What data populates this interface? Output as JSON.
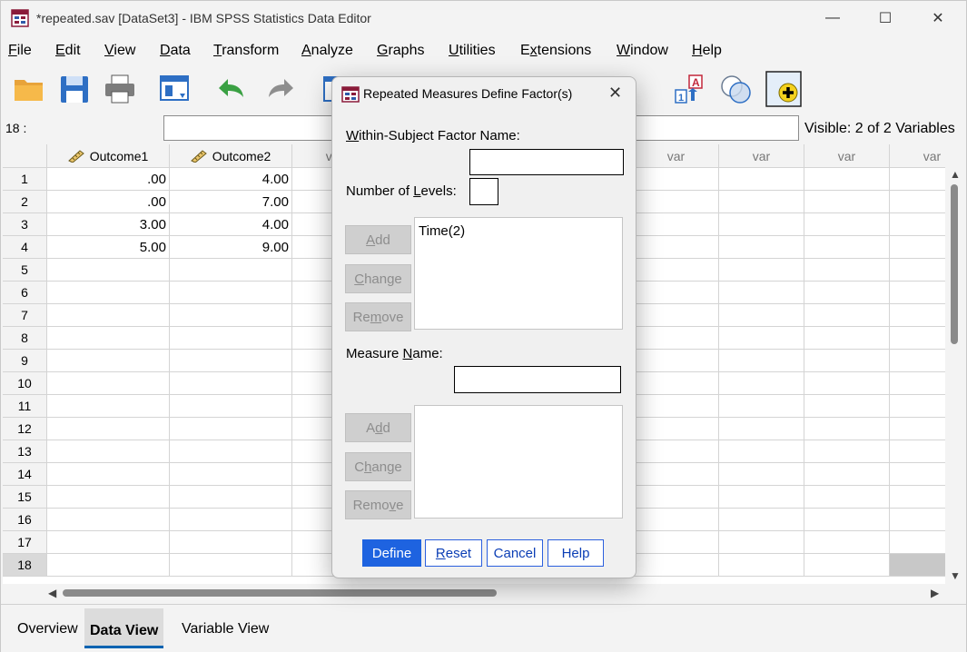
{
  "window": {
    "title": "*repeated.sav [DataSet3] - IBM SPSS Statistics Data Editor",
    "minimize": "—",
    "maximize": "☐",
    "close": "✕"
  },
  "menu": [
    {
      "pre": "",
      "key": "F",
      "post": "ile"
    },
    {
      "pre": "",
      "key": "E",
      "post": "dit"
    },
    {
      "pre": "",
      "key": "V",
      "post": "iew"
    },
    {
      "pre": "",
      "key": "D",
      "post": "ata"
    },
    {
      "pre": "",
      "key": "T",
      "post": "ransform"
    },
    {
      "pre": "",
      "key": "A",
      "post": "nalyze"
    },
    {
      "pre": "",
      "key": "G",
      "post": "raphs"
    },
    {
      "pre": "",
      "key": "U",
      "post": "tilities"
    },
    {
      "pre": "E",
      "key": "x",
      "post": "tensions"
    },
    {
      "pre": "",
      "key": "W",
      "post": "indow"
    },
    {
      "pre": "",
      "key": "H",
      "post": "elp"
    }
  ],
  "cell_ref": "18 :",
  "visible_label": "Visible: 2 of 2 Variables",
  "columns": [
    "Outcome1",
    "Outcome2",
    "var",
    "var",
    "var",
    "var",
    "var",
    "var",
    "var",
    "var"
  ],
  "rows": [
    {
      "num": "1",
      "cells": [
        ".00",
        "4.00"
      ]
    },
    {
      "num": "2",
      "cells": [
        ".00",
        "7.00"
      ]
    },
    {
      "num": "3",
      "cells": [
        "3.00",
        "4.00"
      ]
    },
    {
      "num": "4",
      "cells": [
        "5.00",
        "9.00"
      ]
    },
    {
      "num": "5",
      "cells": [
        "",
        ""
      ]
    },
    {
      "num": "6",
      "cells": [
        "",
        ""
      ]
    },
    {
      "num": "7",
      "cells": [
        "",
        ""
      ]
    },
    {
      "num": "8",
      "cells": [
        "",
        ""
      ]
    },
    {
      "num": "9",
      "cells": [
        "",
        ""
      ]
    },
    {
      "num": "10",
      "cells": [
        "",
        ""
      ]
    },
    {
      "num": "11",
      "cells": [
        "",
        ""
      ]
    },
    {
      "num": "12",
      "cells": [
        "",
        ""
      ]
    },
    {
      "num": "13",
      "cells": [
        "",
        ""
      ]
    },
    {
      "num": "14",
      "cells": [
        "",
        ""
      ]
    },
    {
      "num": "15",
      "cells": [
        "",
        ""
      ]
    },
    {
      "num": "16",
      "cells": [
        "",
        ""
      ]
    },
    {
      "num": "17",
      "cells": [
        "",
        ""
      ]
    },
    {
      "num": "18",
      "cells": [
        "",
        ""
      ]
    }
  ],
  "tabs": {
    "overview": "Overview",
    "data_view": "Data View",
    "variable_view": "Variable View"
  },
  "dialog": {
    "title": "Repeated Measures Define Factor(s)",
    "close": "✕",
    "factor_name_label": {
      "key": "W",
      "post": "ithin-Subject Factor Name:"
    },
    "factor_name_value": "",
    "levels_label": {
      "pre": "Number of ",
      "key": "L",
      "post": "evels:"
    },
    "levels_value": "",
    "factor_list": [
      "Time(2)"
    ],
    "add": {
      "pre": "",
      "key": "A",
      "post": "dd"
    },
    "change": {
      "pre": "",
      "key": "C",
      "post": "hange"
    },
    "remove": {
      "pre": "Re",
      "key": "m",
      "post": "ove"
    },
    "measure_label": {
      "pre": "Measure ",
      "key": "N",
      "post": "ame:"
    },
    "measure_value": "",
    "add2": {
      "pre": "A",
      "key": "d",
      "post": "d"
    },
    "change2": {
      "pre": "C",
      "key": "h",
      "post": "ange"
    },
    "remove2": {
      "pre": "Remo",
      "key": "v",
      "post": "e"
    },
    "define": "Define",
    "reset": {
      "pre": "",
      "key": "R",
      "post": "eset"
    },
    "cancel": "Cancel",
    "help": "Help"
  },
  "icons": {
    "open": "folder-open-icon",
    "save": "save-icon",
    "print": "print-icon",
    "recall": "dialog-recall-icon",
    "undo": "undo-icon",
    "redo": "redo-icon",
    "value_labels": "value-labels-icon",
    "split": "split-file-icon",
    "weight": "weight-cases-icon",
    "sets": "use-sets-icon",
    "extension": "extension-hub-icon"
  },
  "colors": {
    "accent": "#1e63e0",
    "tab_underline": "#0063b1"
  }
}
